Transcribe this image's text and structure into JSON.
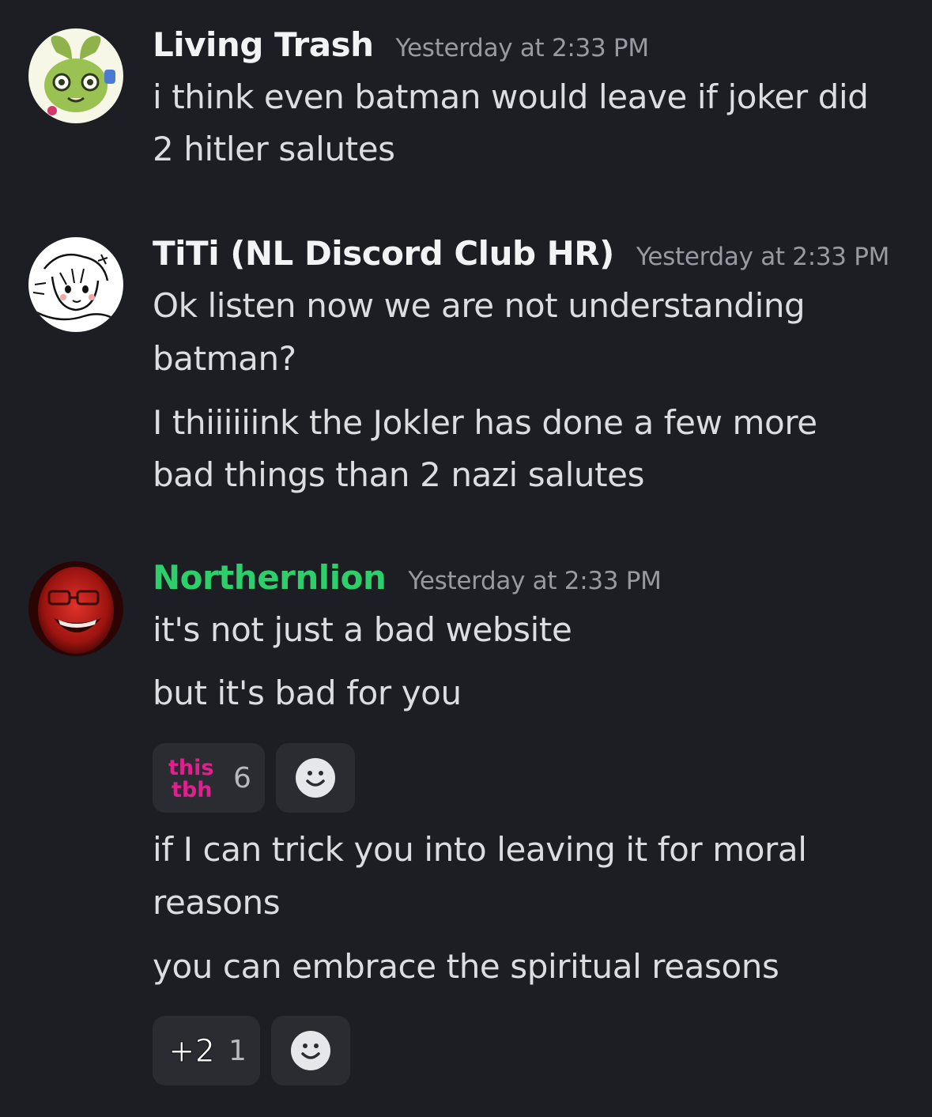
{
  "messages": [
    {
      "username": "Living Trash",
      "timestamp": "Yesterday at 2:33 PM",
      "avatar_icon": "green-creature-avatar-icon",
      "lines": [
        "i think even batman would leave if joker did",
        "2 hitler salutes"
      ]
    },
    {
      "username": "TiTi (NL Discord Club HR)",
      "timestamp": "Yesterday at 2:33 PM",
      "avatar_icon": "sketch-girl-avatar-icon",
      "lines": [
        "Ok listen now we are not understanding",
        "batman?",
        "I thiiiiiink the Jokler has done a few more",
        "bad things than 2 nazi salutes"
      ]
    },
    {
      "username": "Northernlion",
      "timestamp": "Yesterday at 2:33 PM",
      "avatar_icon": "red-laughing-man-avatar-icon",
      "name_color": "#2dcf6b",
      "lines": [
        "it's not just a bad website",
        "but it's bad for you",
        "if I can trick you into leaving it for moral",
        "reasons",
        "you can embrace the spiritual reasons"
      ],
      "reactions": [
        {
          "emoji": "this-tbh-emoji",
          "emoji_text": [
            "this",
            "tbh"
          ],
          "count": "6"
        },
        {
          "emoji": "plus-two-emoji",
          "emoji_text": "+2",
          "count": "1"
        }
      ]
    }
  ],
  "colors": {
    "background": "#1d1e23",
    "reaction_bg": "#2b2c32",
    "username": "#f2f3f5",
    "northernlion": "#2dcf6b",
    "timestamp": "#989aa2",
    "message": "#dcdde1",
    "this_tbh_emoji": "#e0208f"
  }
}
